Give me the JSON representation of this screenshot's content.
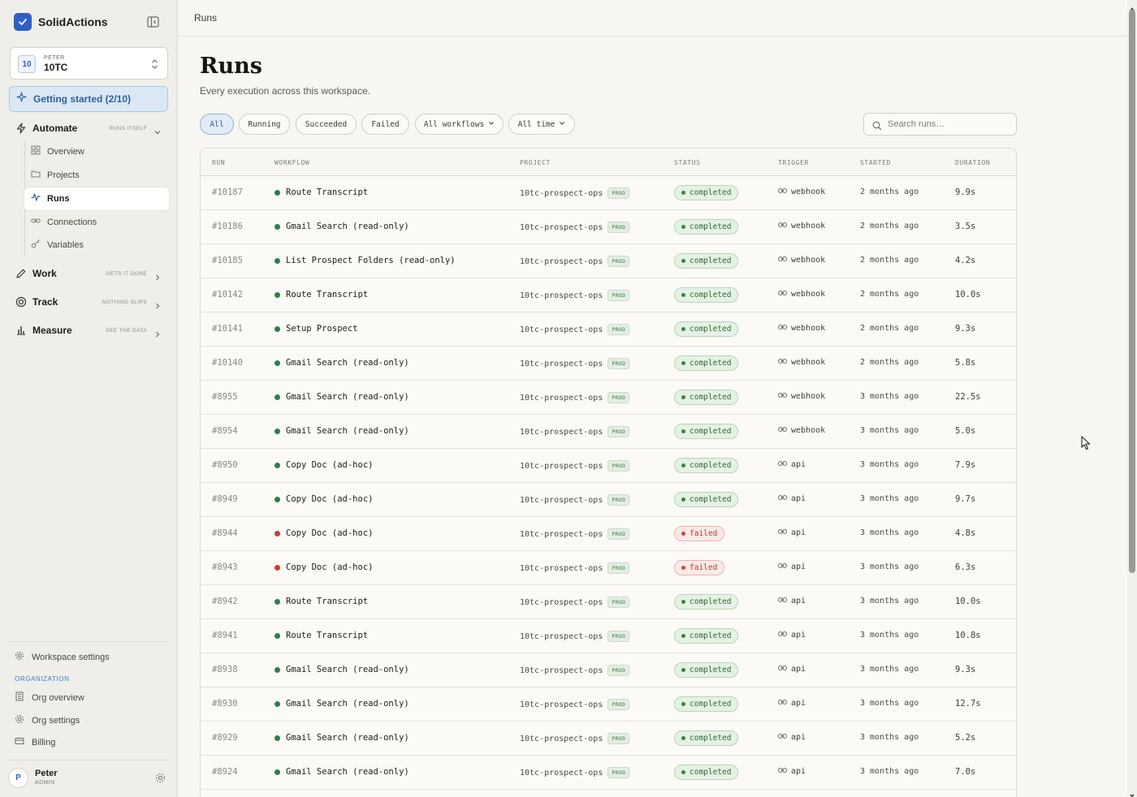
{
  "app": {
    "name": "SolidActions"
  },
  "workspace": {
    "badge": "10",
    "owner": "PETER",
    "name": "10TC"
  },
  "getting_started": {
    "label": "Getting started (2/10)"
  },
  "nav": {
    "automate": {
      "label": "Automate",
      "tag": "RUNS ITSELF"
    },
    "work": {
      "label": "Work",
      "tag": "GETS IT DONE"
    },
    "track": {
      "label": "Track",
      "tag": "NOTHING SLIPS"
    },
    "measure": {
      "label": "Measure",
      "tag": "SEE THE DATA"
    },
    "sub": [
      {
        "label": "Overview",
        "icon": "grid-icon"
      },
      {
        "label": "Projects",
        "icon": "folder-icon"
      },
      {
        "label": "Runs",
        "icon": "activity-icon",
        "active": true
      },
      {
        "label": "Connections",
        "icon": "link-icon"
      },
      {
        "label": "Variables",
        "icon": "key-icon"
      }
    ]
  },
  "footer_nav": {
    "workspace_settings": "Workspace settings",
    "org_label": "ORGANIZATION",
    "org_overview": "Org overview",
    "org_settings": "Org settings",
    "billing": "Billing"
  },
  "user": {
    "initial": "P",
    "name": "Peter",
    "role": "ADMIN"
  },
  "breadcrumb": "Runs",
  "page": {
    "title": "Runs",
    "subtitle": "Every execution across this workspace."
  },
  "filters": {
    "all": "All",
    "running": "Running",
    "succeeded": "Succeeded",
    "failed": "Failed",
    "workflows": "All workflows",
    "time": "All time"
  },
  "search": {
    "placeholder": "Search runs…"
  },
  "table": {
    "headers": {
      "run": "RUN",
      "workflow": "WORKFLOW",
      "project": "PROJECT",
      "status": "STATUS",
      "trigger": "TRIGGER",
      "started": "STARTED",
      "duration": "DURATION"
    },
    "rows": [
      {
        "run": "#10187",
        "workflow": "Route Transcript",
        "project": "10tc-prospect-ops",
        "env": "PROD",
        "status": "completed",
        "trigger": "webhook",
        "started": "2 months ago",
        "duration": "9.9s"
      },
      {
        "run": "#10186",
        "workflow": "Gmail Search (read-only)",
        "project": "10tc-prospect-ops",
        "env": "PROD",
        "status": "completed",
        "trigger": "webhook",
        "started": "2 months ago",
        "duration": "3.5s"
      },
      {
        "run": "#10185",
        "workflow": "List Prospect Folders (read-only)",
        "project": "10tc-prospect-ops",
        "env": "PROD",
        "status": "completed",
        "trigger": "webhook",
        "started": "2 months ago",
        "duration": "4.2s"
      },
      {
        "run": "#10142",
        "workflow": "Route Transcript",
        "project": "10tc-prospect-ops",
        "env": "PROD",
        "status": "completed",
        "trigger": "webhook",
        "started": "2 months ago",
        "duration": "10.0s"
      },
      {
        "run": "#10141",
        "workflow": "Setup Prospect",
        "project": "10tc-prospect-ops",
        "env": "PROD",
        "status": "completed",
        "trigger": "webhook",
        "started": "2 months ago",
        "duration": "9.3s"
      },
      {
        "run": "#10140",
        "workflow": "Gmail Search (read-only)",
        "project": "10tc-prospect-ops",
        "env": "PROD",
        "status": "completed",
        "trigger": "webhook",
        "started": "2 months ago",
        "duration": "5.8s"
      },
      {
        "run": "#8955",
        "workflow": "Gmail Search (read-only)",
        "project": "10tc-prospect-ops",
        "env": "PROD",
        "status": "completed",
        "trigger": "webhook",
        "started": "3 months ago",
        "duration": "22.5s"
      },
      {
        "run": "#8954",
        "workflow": "Gmail Search (read-only)",
        "project": "10tc-prospect-ops",
        "env": "PROD",
        "status": "completed",
        "trigger": "webhook",
        "started": "3 months ago",
        "duration": "5.0s"
      },
      {
        "run": "#8950",
        "workflow": "Copy Doc (ad-hoc)",
        "project": "10tc-prospect-ops",
        "env": "PROD",
        "status": "completed",
        "trigger": "api",
        "started": "3 months ago",
        "duration": "7.9s"
      },
      {
        "run": "#8949",
        "workflow": "Copy Doc (ad-hoc)",
        "project": "10tc-prospect-ops",
        "env": "PROD",
        "status": "completed",
        "trigger": "api",
        "started": "3 months ago",
        "duration": "9.7s"
      },
      {
        "run": "#8944",
        "workflow": "Copy Doc (ad-hoc)",
        "project": "10tc-prospect-ops",
        "env": "PROD",
        "status": "failed",
        "trigger": "api",
        "started": "3 months ago",
        "duration": "4.8s"
      },
      {
        "run": "#8943",
        "workflow": "Copy Doc (ad-hoc)",
        "project": "10tc-prospect-ops",
        "env": "PROD",
        "status": "failed",
        "trigger": "api",
        "started": "3 months ago",
        "duration": "6.3s"
      },
      {
        "run": "#8942",
        "workflow": "Route Transcript",
        "project": "10tc-prospect-ops",
        "env": "PROD",
        "status": "completed",
        "trigger": "api",
        "started": "3 months ago",
        "duration": "10.0s"
      },
      {
        "run": "#8941",
        "workflow": "Route Transcript",
        "project": "10tc-prospect-ops",
        "env": "PROD",
        "status": "completed",
        "trigger": "api",
        "started": "3 months ago",
        "duration": "10.8s"
      },
      {
        "run": "#8938",
        "workflow": "Gmail Search (read-only)",
        "project": "10tc-prospect-ops",
        "env": "PROD",
        "status": "completed",
        "trigger": "api",
        "started": "3 months ago",
        "duration": "9.3s"
      },
      {
        "run": "#8930",
        "workflow": "Gmail Search (read-only)",
        "project": "10tc-prospect-ops",
        "env": "PROD",
        "status": "completed",
        "trigger": "api",
        "started": "3 months ago",
        "duration": "12.7s"
      },
      {
        "run": "#8929",
        "workflow": "Gmail Search (read-only)",
        "project": "10tc-prospect-ops",
        "env": "PROD",
        "status": "completed",
        "trigger": "api",
        "started": "3 months ago",
        "duration": "5.2s"
      },
      {
        "run": "#8924",
        "workflow": "Gmail Search (read-only)",
        "project": "10tc-prospect-ops",
        "env": "PROD",
        "status": "completed",
        "trigger": "api",
        "started": "3 months ago",
        "duration": "7.0s"
      }
    ]
  },
  "colors": {
    "accent": "#2f5fc4",
    "completed": "#2e8a43",
    "failed": "#d0453a",
    "workflow_dot_ok": "#2e7d4f",
    "workflow_dot_fail": "#cc3b36"
  }
}
